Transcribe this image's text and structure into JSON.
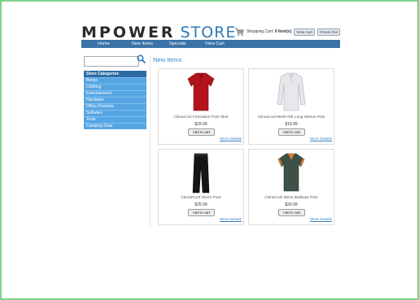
{
  "logo": {
    "brand": "MPOWER",
    "store": "STORE"
  },
  "cart": {
    "label": "Shopping Cart:",
    "count_text": "0 Item(s)",
    "view_cart": "View Cart",
    "check_out": "Check Out",
    "icon": "shopping-cart-icon"
  },
  "nav": {
    "items": [
      "Home",
      "New Items",
      "Specials",
      "View Cart"
    ]
  },
  "search": {
    "placeholder": "",
    "icon": "search-icon"
  },
  "categories": {
    "title": "Store Categories",
    "items": [
      "Books",
      "Clothing",
      "Entertainment",
      "Hardware",
      "Office Products",
      "Software",
      "Tools",
      "Camping Gear"
    ]
  },
  "main": {
    "title": "New Items",
    "products": [
      {
        "name": "ClimaCool Formation Polo Shirt",
        "price": "$29.99",
        "add": "Add to cart",
        "more": "More Details",
        "image": "red-polo-shirt",
        "color": "#b3141b"
      },
      {
        "name": "ClimaCool Mesh Rib Long Sleeve Polo",
        "price": "$19.99",
        "add": "Add to cart",
        "more": "More Details",
        "image": "white-long-sleeve-polo",
        "color": "#e6e8ec"
      },
      {
        "name": "ClimaProof Storm Pant",
        "price": "$25.99",
        "add": "Add to cart",
        "more": "More Details",
        "image": "black-pants",
        "color": "#151515"
      },
      {
        "name": "ClimaCool Mens Bullseye Polo",
        "price": "$29.99",
        "add": "Add to cart",
        "more": "More Details",
        "image": "green-polo-shirt",
        "color": "#3d5147"
      }
    ]
  }
}
